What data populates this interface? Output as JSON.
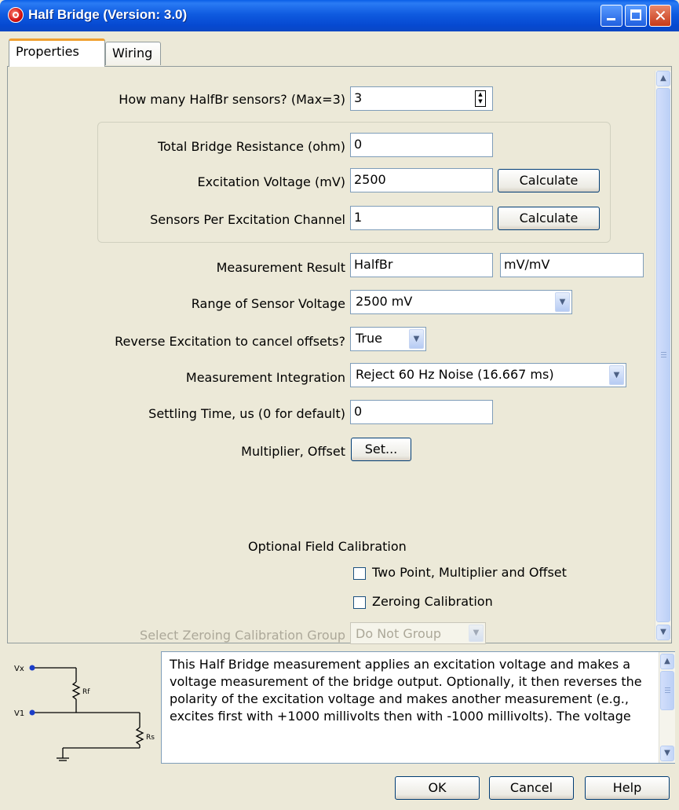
{
  "window": {
    "title": "Half Bridge (Version: 3.0)",
    "icon": "app-icon",
    "controls": [
      "minimize-icon",
      "maximize-icon",
      "close-icon"
    ],
    "title_color": "#0A4FD6"
  },
  "tabs": [
    {
      "label": "Properties",
      "active": true
    },
    {
      "label": "Wiring",
      "active": false
    }
  ],
  "form": {
    "sensors": {
      "label": "How many HalfBr sensors? (Max=3)",
      "value": "3"
    },
    "resistance": {
      "label": "Total Bridge Resistance (ohm)",
      "value": "0"
    },
    "excitation": {
      "label": "Excitation Voltage (mV)",
      "value": "2500",
      "button": "Calculate"
    },
    "per_channel": {
      "label": "Sensors Per Excitation Channel",
      "value": "1",
      "button": "Calculate"
    },
    "result": {
      "label": "Measurement Result",
      "value": "HalfBr",
      "units": "mV/mV"
    },
    "range": {
      "label": "Range of Sensor Voltage",
      "value": "2500 mV"
    },
    "reverse": {
      "label": "Reverse Excitation to cancel offsets?",
      "value": "True"
    },
    "integration": {
      "label": "Measurement Integration",
      "value": "Reject 60 Hz Noise (16.667 ms)"
    },
    "settling": {
      "label": "Settling Time, us (0 for default)",
      "value": "0"
    },
    "multiplier": {
      "label": "Multiplier, Offset",
      "button": "Set..."
    },
    "calibration": {
      "heading": "Optional Field Calibration",
      "two_point": {
        "label": "Two Point, Multiplier and Offset",
        "checked": false
      },
      "zeroing": {
        "label": "Zeroing Calibration",
        "checked": false
      },
      "group": {
        "label": "Select Zeroing Calibration Group",
        "value": "Do Not Group",
        "disabled": true
      }
    }
  },
  "diagram": {
    "labels": {
      "vx": "Vx",
      "v1": "V1",
      "rf": "Rf",
      "rs": "Rs"
    }
  },
  "help_text": "This Half Bridge measurement applies an excitation voltage and makes a voltage measurement of the bridge output. Optionally, it then reverses the polarity of the excitation voltage and makes another measurement (e.g., excites first with +1000 millivolts then with -1000 millivolts). The voltage",
  "buttons": {
    "ok": "OK",
    "cancel": "Cancel",
    "help": "Help"
  }
}
